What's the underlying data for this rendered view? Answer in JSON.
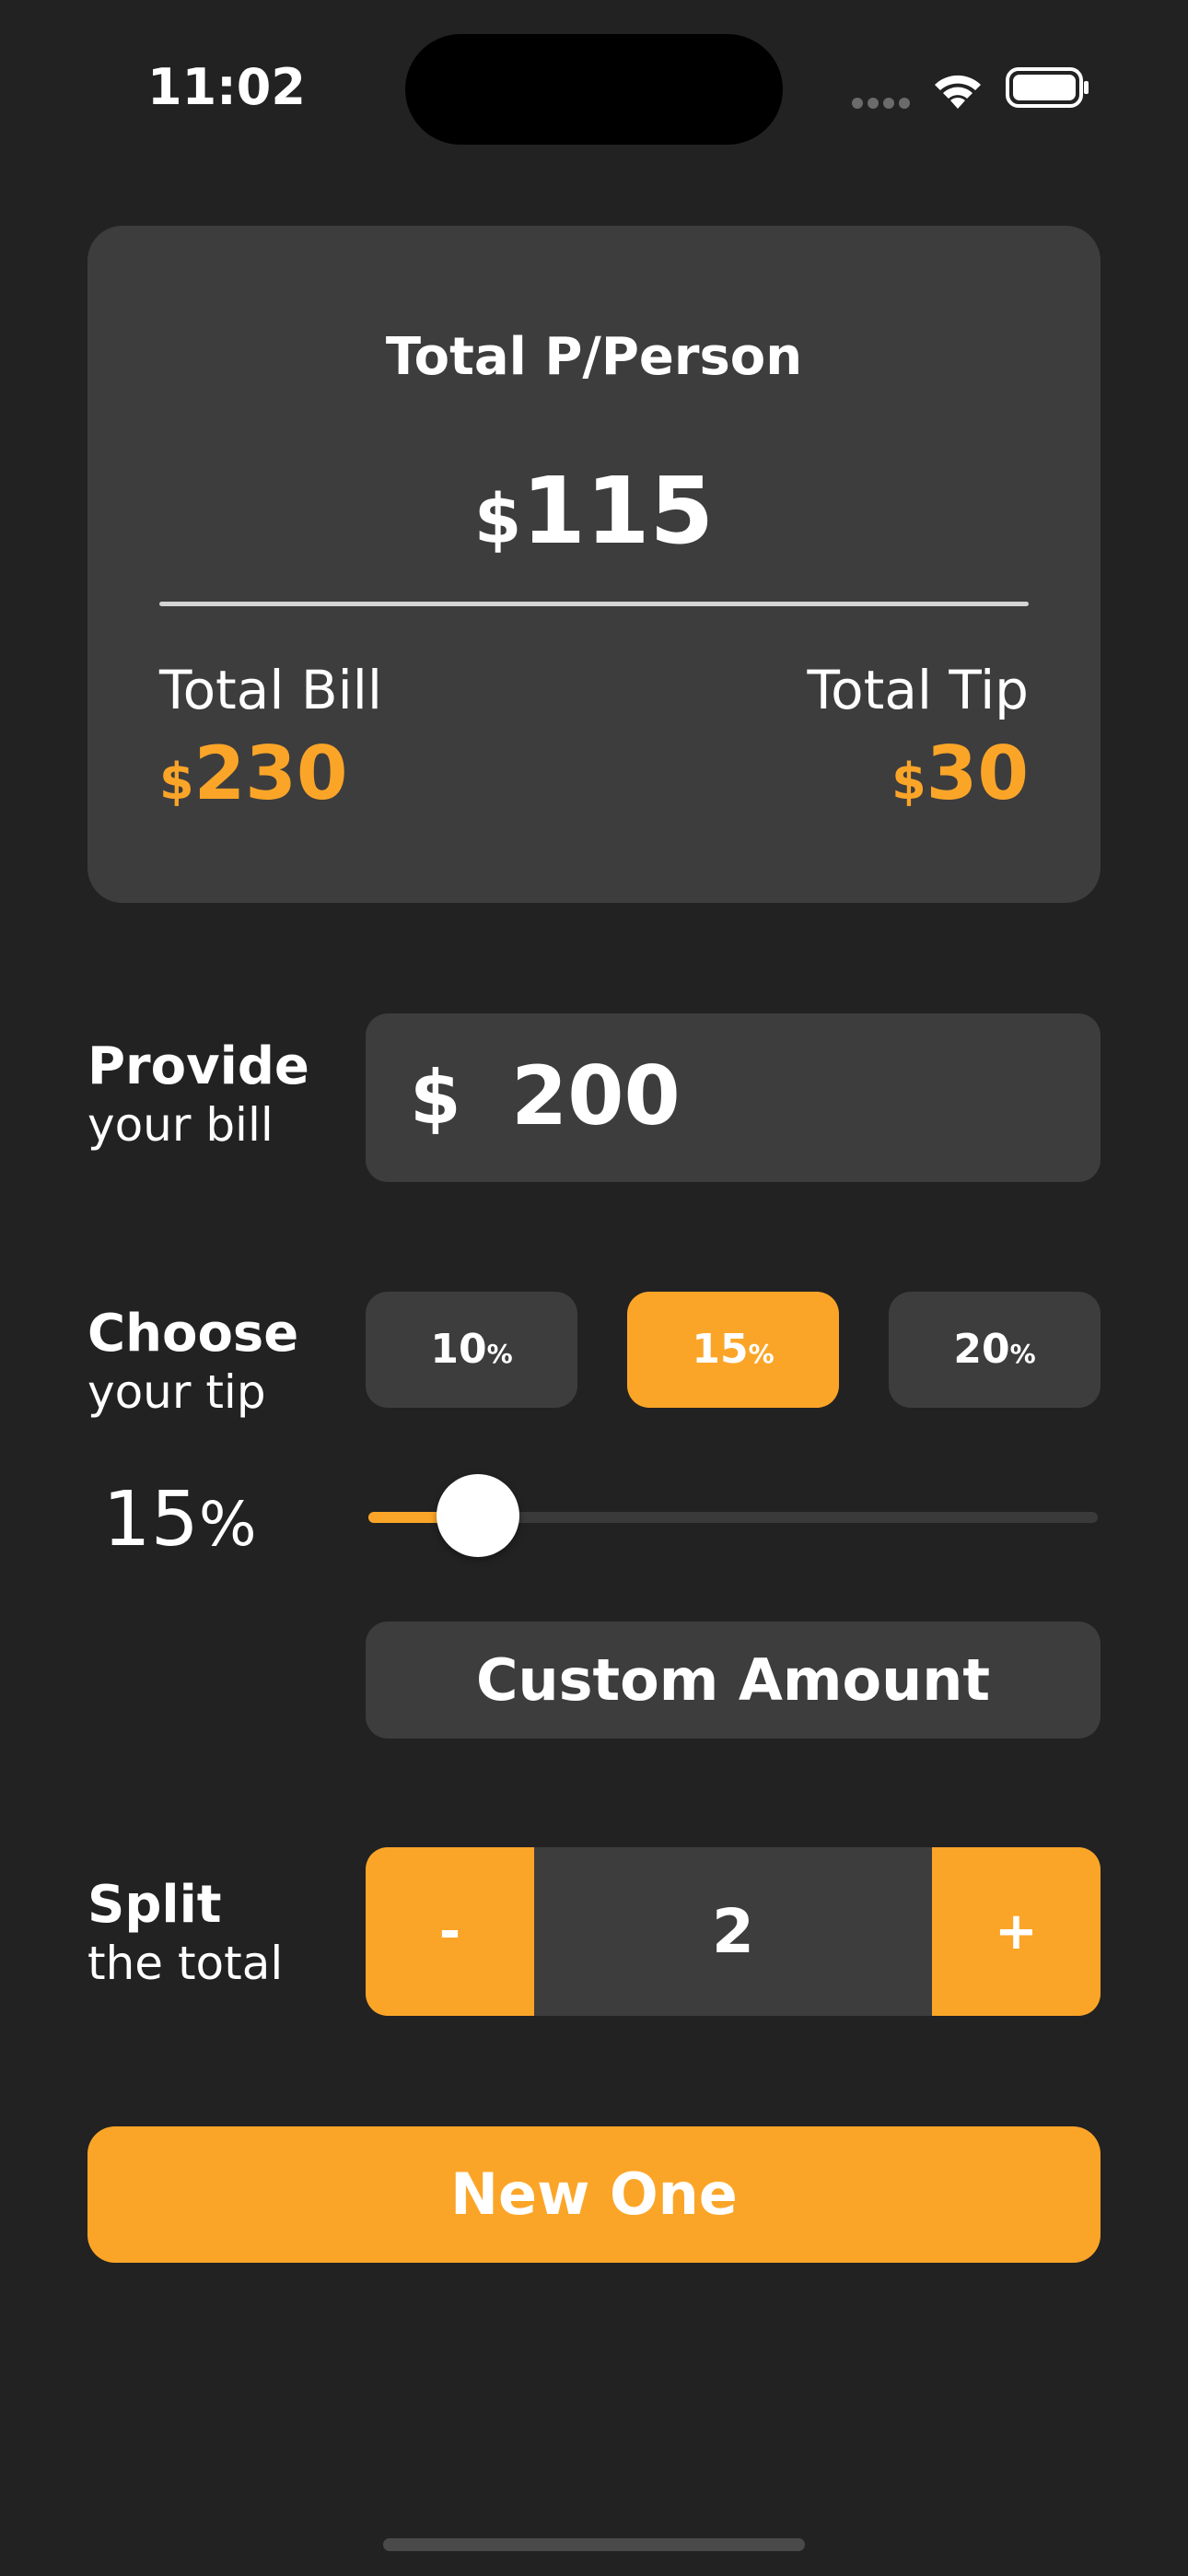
{
  "status_bar": {
    "time": "11:02",
    "icons": [
      "cellular-signal-icon",
      "wifi-icon",
      "battery-icon"
    ]
  },
  "summary": {
    "title": "Total P/Person",
    "per_person": {
      "currency": "$",
      "value": "115"
    },
    "total_bill": {
      "label": "Total Bill",
      "currency": "$",
      "value": "230"
    },
    "total_tip": {
      "label": "Total Tip",
      "currency": "$",
      "value": "30"
    }
  },
  "bill": {
    "label_main": "Provide",
    "label_sub": "your bill",
    "currency": "$",
    "value": "200"
  },
  "tip": {
    "label_main": "Choose",
    "label_sub": "your tip",
    "options": [
      {
        "value": "10",
        "suffix": "%"
      },
      {
        "value": "15",
        "suffix": "%"
      },
      {
        "value": "20",
        "suffix": "%"
      }
    ],
    "selected_index": 1,
    "current": {
      "value": "15",
      "suffix": "%"
    },
    "slider_fraction": 0.15,
    "custom_label": "Custom Amount"
  },
  "split": {
    "label_main": "Split",
    "label_sub": "the total",
    "minus_label": "-",
    "plus_label": "+",
    "value": "2"
  },
  "actions": {
    "new_label": "New One"
  },
  "colors": {
    "background": "#222222",
    "card": "#3d3d3d",
    "accent": "#fba528",
    "text": "#ffffff"
  }
}
